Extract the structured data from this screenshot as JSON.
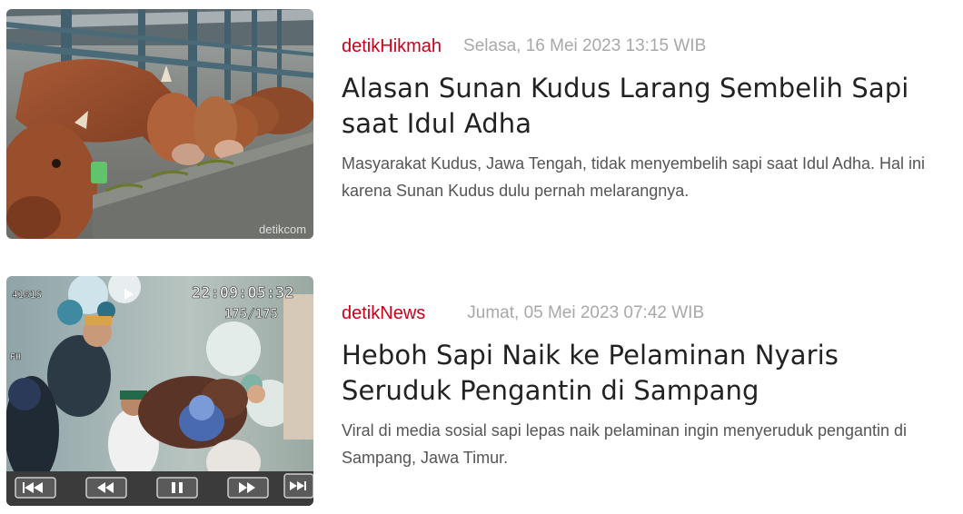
{
  "articles": [
    {
      "channel": "detikHikmah",
      "date": "Selasa, 16 Mei 2023 13:15 WIB",
      "title": "Alasan Sunan Kudus Larang Sembelih Sapi saat Idul Adha",
      "summary": "Masyarakat Kudus, Jawa Tengah, tidak menyembelih sapi saat Idul Adha. Hal ini karena Sunan Kudus dulu pernah melarangnya.",
      "image_watermark": "detikcom"
    },
    {
      "channel": "detikNews",
      "date": "Jumat, 05 Mei 2023 07:42 WIB",
      "title": "Heboh Sapi Naik ke Pelaminan Nyaris Seruduk Pengantin di Sampang",
      "summary": "Viral di media sosial sapi lepas naik pelaminan ingin menyeruduk pengantin di Sampang, Jawa Timur.",
      "video_overlay": {
        "timestamp": "22:09:05:32",
        "frame_counter": "175/175",
        "corner_label": "4181S",
        "side_label": "FH"
      }
    }
  ],
  "colors": {
    "channel": "#c9001a",
    "date": "#a8a8a8",
    "title": "#222222",
    "summary": "#555555"
  }
}
